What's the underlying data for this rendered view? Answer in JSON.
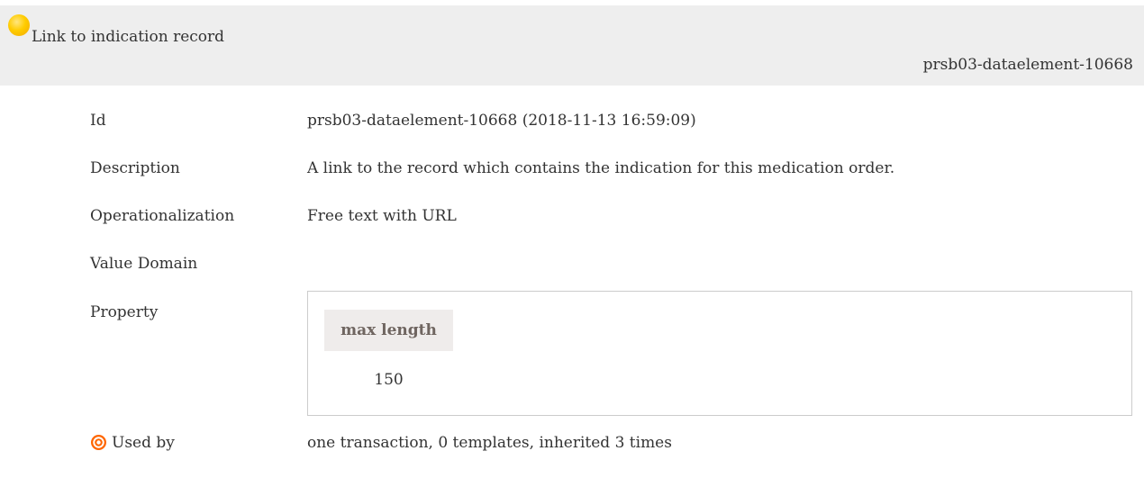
{
  "header": {
    "title": "Link to indication record",
    "element_id": "prsb03-dataelement-10668",
    "status_icon": "status-draft-yellow-circle-icon",
    "status_color": "#ffcc00"
  },
  "rows": {
    "id": {
      "label": "Id",
      "value": "prsb03-dataelement-10668 (2018-11-13 16:59:09)"
    },
    "description": {
      "label": "Description",
      "value": "A link to the record which contains the indication for this medication order."
    },
    "operationalization": {
      "label": "Operationalization",
      "value": "Free text with URL"
    },
    "value_domain": {
      "label": "Value Domain",
      "value": ""
    },
    "property": {
      "label": "Property",
      "table": {
        "header": "max length",
        "value": "150"
      }
    },
    "used_by": {
      "label": "Used by",
      "icon": "target-icon",
      "icon_color": "#ff6600",
      "value": "one transaction, 0 templates, inherited 3 times"
    }
  }
}
